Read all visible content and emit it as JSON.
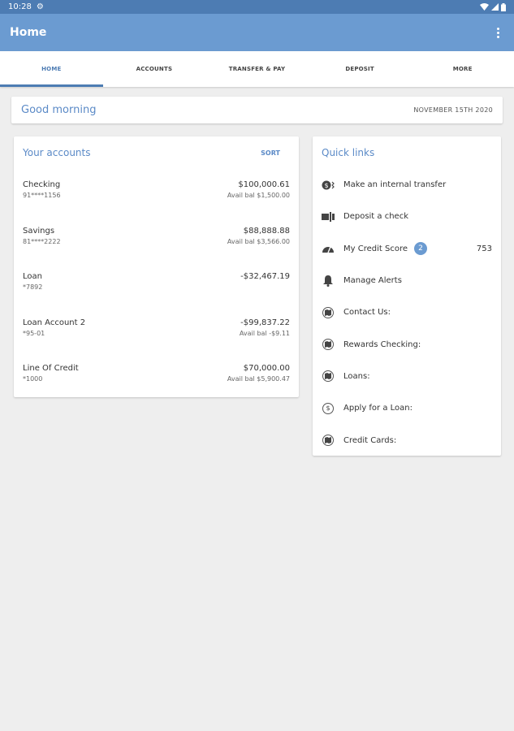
{
  "status_bar": {
    "time": "10:28"
  },
  "app_bar": {
    "title": "Home"
  },
  "tabs": [
    {
      "label": "HOME",
      "active": true
    },
    {
      "label": "ACCOUNTS",
      "active": false
    },
    {
      "label": "TRANSFER & PAY",
      "active": false
    },
    {
      "label": "DEPOSIT",
      "active": false
    },
    {
      "label": "MORE",
      "active": false
    }
  ],
  "greeting": {
    "text": "Good morning",
    "date": "NOVEMBER 15TH 2020"
  },
  "accounts": {
    "title": "Your accounts",
    "sort_label": "SORT",
    "items": [
      {
        "name": "Checking",
        "number": "91****1156",
        "balance": "$100,000.61",
        "available": "Avail bal $1,500.00"
      },
      {
        "name": "Savings",
        "number": "81****2222",
        "balance": "$88,888.88",
        "available": "Avail bal $3,566.00"
      },
      {
        "name": "Loan",
        "number": "*7892",
        "balance": "-$32,467.19",
        "available": ""
      },
      {
        "name": "Loan Account 2",
        "number": "*95-01",
        "balance": "-$99,837.22",
        "available": "Avail bal -$9.11"
      },
      {
        "name": "Line Of Credit",
        "number": "*1000",
        "balance": "$70,000.00",
        "available": "Avail bal $5,900.47"
      }
    ]
  },
  "quick_links": {
    "title": "Quick links",
    "items": [
      {
        "label": "Make an internal transfer",
        "icon": "transfer-icon"
      },
      {
        "label": "Deposit a check",
        "icon": "check-deposit-icon"
      },
      {
        "label": "My Credit Score",
        "icon": "gauge-icon",
        "badge": "2",
        "score": "753"
      },
      {
        "label": "Manage Alerts",
        "icon": "bell-icon"
      },
      {
        "label": "Contact Us:",
        "icon": "map-icon"
      },
      {
        "label": "Rewards Checking:",
        "icon": "map-icon"
      },
      {
        "label": "Loans:",
        "icon": "map-icon"
      },
      {
        "label": "Apply for a Loan:",
        "icon": "dollar-icon",
        "icon_glyph": "$"
      },
      {
        "label": "Credit Cards:",
        "icon": "map-icon"
      }
    ]
  },
  "colors": {
    "status_bar": "#4d7cb3",
    "app_bar": "#6b9bd1",
    "accent": "#5b8ac7",
    "background": "#eeeeee"
  }
}
